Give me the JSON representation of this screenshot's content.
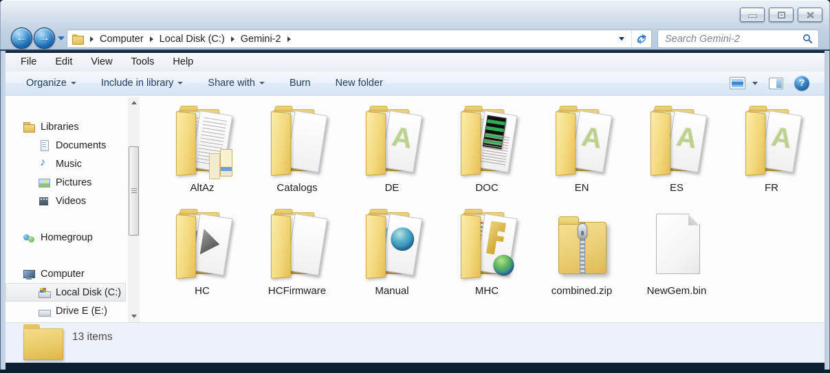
{
  "window": {
    "controls": [
      {
        "name": "minimize"
      },
      {
        "name": "maximize"
      },
      {
        "name": "close"
      }
    ]
  },
  "address": {
    "crumbs": [
      {
        "label": "Computer"
      },
      {
        "label": "Local Disk (C:)"
      },
      {
        "label": "Gemini-2"
      }
    ]
  },
  "search": {
    "placeholder": "Search Gemini-2"
  },
  "menu": {
    "items": [
      {
        "label": "File"
      },
      {
        "label": "Edit"
      },
      {
        "label": "View"
      },
      {
        "label": "Tools"
      },
      {
        "label": "Help"
      }
    ]
  },
  "toolbar": {
    "items": [
      {
        "label": "Organize",
        "dropdown": true
      },
      {
        "label": "Include in library",
        "dropdown": true
      },
      {
        "label": "Share with",
        "dropdown": true
      },
      {
        "label": "Burn",
        "dropdown": false
      },
      {
        "label": "New folder",
        "dropdown": false
      }
    ]
  },
  "sidebar": {
    "items": [
      {
        "label": "Libraries",
        "icon": "libraries",
        "level": 0,
        "gap": false,
        "selected": false
      },
      {
        "label": "Documents",
        "icon": "documents",
        "level": 1,
        "gap": false,
        "selected": false
      },
      {
        "label": "Music",
        "icon": "music",
        "level": 1,
        "gap": false,
        "selected": false
      },
      {
        "label": "Pictures",
        "icon": "pictures",
        "level": 1,
        "gap": false,
        "selected": false
      },
      {
        "label": "Videos",
        "icon": "videos",
        "level": 1,
        "gap": false,
        "selected": false
      },
      {
        "label": "Homegroup",
        "icon": "homegroup",
        "level": 0,
        "gap": true,
        "selected": false
      },
      {
        "label": "Computer",
        "icon": "computer",
        "level": 0,
        "gap": true,
        "selected": false
      },
      {
        "label": "Local Disk (C:)",
        "icon": "disk",
        "level": 1,
        "gap": false,
        "selected": true
      },
      {
        "label": "Drive E (E:)",
        "icon": "drive",
        "level": 1,
        "gap": false,
        "selected": false
      }
    ]
  },
  "files": {
    "items": [
      {
        "label": "AltAz",
        "icon": "folder-text"
      },
      {
        "label": "Catalogs",
        "icon": "folder-blank"
      },
      {
        "label": "DE",
        "icon": "folder-pdf"
      },
      {
        "label": "DOC",
        "icon": "folder-doc"
      },
      {
        "label": "EN",
        "icon": "folder-pdf"
      },
      {
        "label": "ES",
        "icon": "folder-pdf"
      },
      {
        "label": "FR",
        "icon": "folder-pdf"
      },
      {
        "label": "HC",
        "icon": "folder-arrow"
      },
      {
        "label": "HCFirmware",
        "icon": "folder-blank"
      },
      {
        "label": "Manual",
        "icon": "folder-globe"
      },
      {
        "label": "MHC",
        "icon": "folder-key"
      },
      {
        "label": "combined.zip",
        "icon": "zip"
      },
      {
        "label": "NewGem.bin",
        "icon": "file-bin"
      }
    ]
  },
  "status": {
    "text": "13 items"
  },
  "colors": {
    "accent_blue": "#2d6fb4",
    "folder_yellow": "#eccf72",
    "glass_blue": "#c2d2e4",
    "pane_blue": "#edf2fa"
  }
}
